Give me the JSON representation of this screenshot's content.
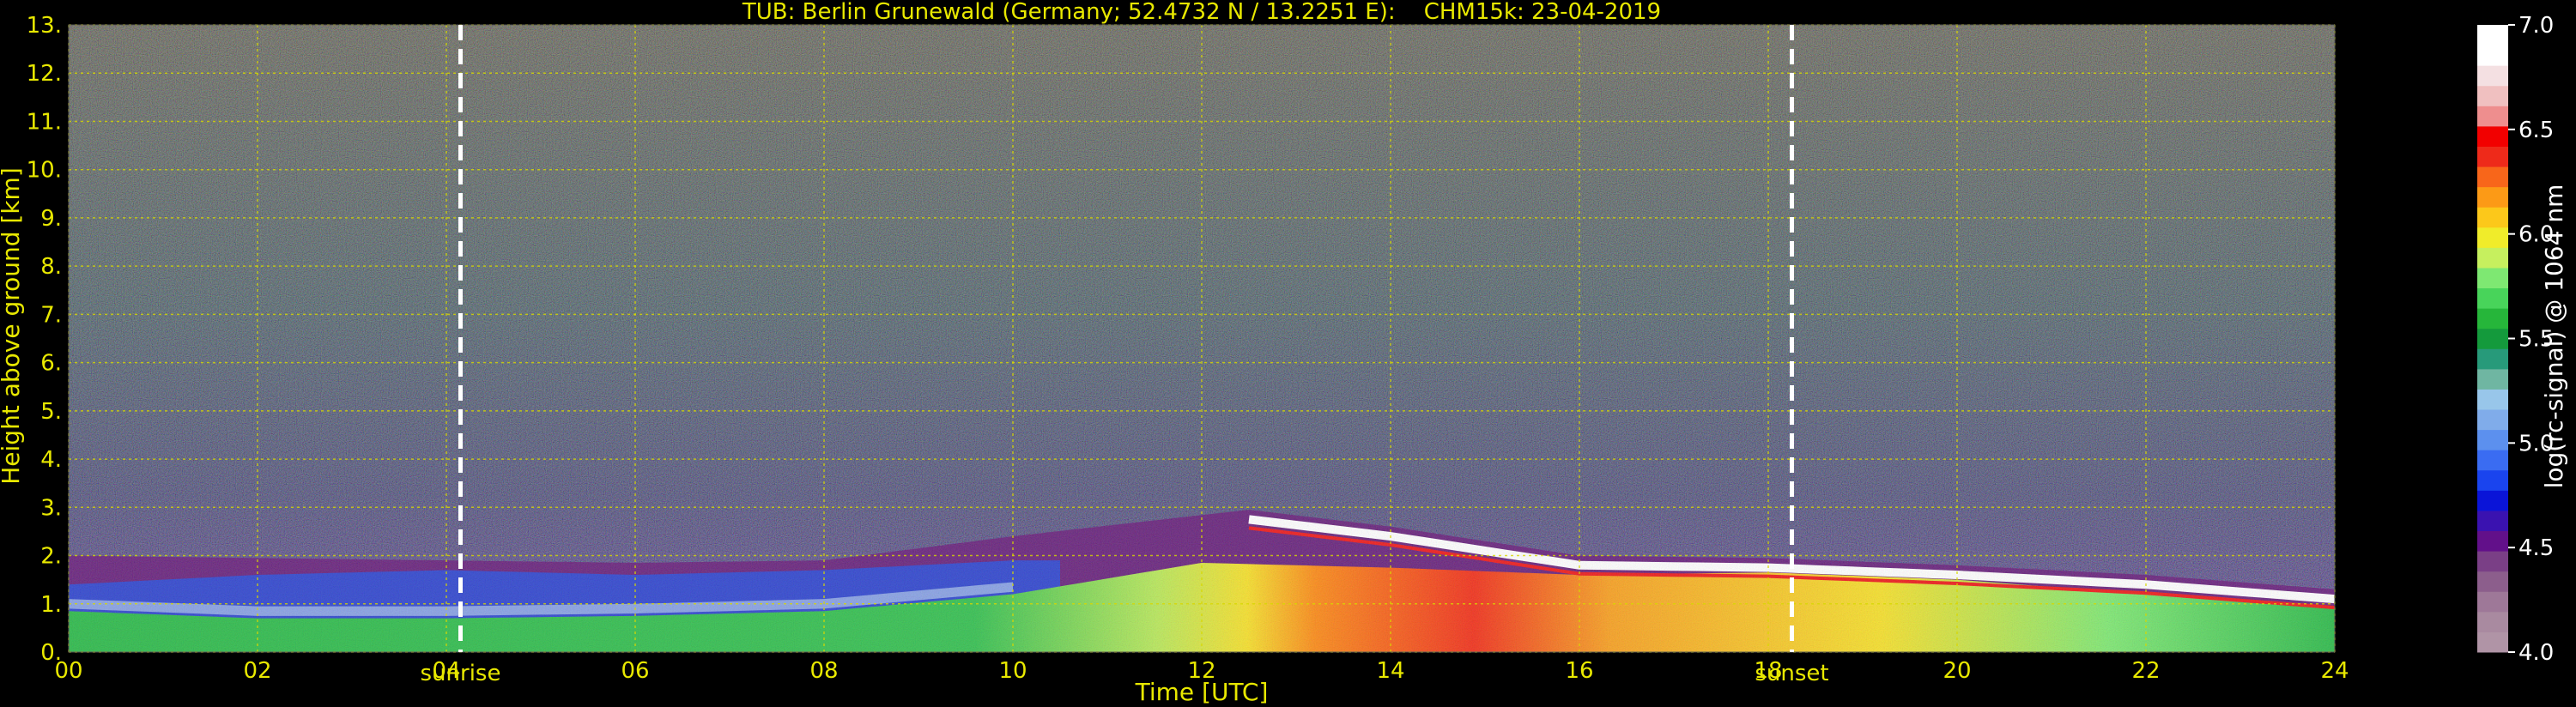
{
  "chart_data": {
    "type": "heatmap",
    "title": "TUB: Berlin Grunewald (Germany; 52.4732 N / 13.2251 E):    CHM15k: 23-04-2019",
    "xlabel": "Time [UTC]",
    "ylabel": "Height above ground [km]",
    "xlim": [
      0,
      24
    ],
    "ylim": [
      0,
      13
    ],
    "x_ticks": [
      "00",
      "02",
      "04",
      "06",
      "08",
      "10",
      "12",
      "14",
      "16",
      "18",
      "20",
      "22",
      "24"
    ],
    "y_ticks": [
      "0.",
      "1.",
      "2.",
      "3.",
      "4.",
      "5.",
      "6.",
      "7.",
      "8.",
      "9.",
      "10.",
      "11.",
      "12.",
      "13."
    ],
    "grid": true,
    "annotations": [
      {
        "label": "sunrise",
        "x": 4.15
      },
      {
        "label": "sunset",
        "x": 18.25
      }
    ],
    "colorbar": {
      "label": "log(rc-signal) @ 1064 nm",
      "range": [
        4.0,
        7.0
      ],
      "ticks": [
        "4.0",
        "4.5",
        "5.0",
        "5.5",
        "6.0",
        "6.5",
        "7.0"
      ],
      "colors": [
        "#b094a6",
        "#a98aa0",
        "#9e7898",
        "#8c5e8c",
        "#7a3f86",
        "#62108a",
        "#3a12b0",
        "#0a14d8",
        "#1a44ee",
        "#3a6cf2",
        "#5c90ee",
        "#80acea",
        "#98c6ea",
        "#6fb6a2",
        "#279a7a",
        "#149a3c",
        "#26b63a",
        "#48d45a",
        "#7ee872",
        "#c6f05e",
        "#f0ec2a",
        "#fcc81a",
        "#fc9a16",
        "#f8661a",
        "#ee2a1a",
        "#f20000",
        "#ee8e8e",
        "#f0c0c0",
        "#f4e0e2",
        "#ffffff",
        "#ffffff"
      ]
    },
    "layers": [
      {
        "name": "sky",
        "from": 3.8,
        "to": 13,
        "t0": 0,
        "t1": 24
      },
      {
        "name": "boundary_layer_top",
        "time": [
          0,
          2,
          4,
          6,
          8,
          10,
          12.5,
          14,
          16,
          18,
          20,
          22,
          24
        ],
        "height": [
          2.0,
          1.95,
          1.9,
          1.85,
          1.9,
          2.4,
          2.95,
          2.6,
          2.0,
          1.95,
          1.8,
          1.6,
          1.3
        ]
      },
      {
        "name": "residual_layer_top",
        "time": [
          0,
          2,
          4,
          6,
          8,
          10
        ],
        "height": [
          1.4,
          1.6,
          1.7,
          1.6,
          1.7,
          1.9
        ]
      },
      {
        "name": "mixed_layer_top",
        "time": [
          0,
          2,
          4,
          6,
          8,
          10,
          12,
          14,
          16,
          18,
          20,
          22,
          24
        ],
        "height": [
          0.85,
          0.7,
          0.7,
          0.75,
          0.85,
          1.2,
          1.85,
          1.75,
          1.6,
          1.65,
          1.5,
          1.2,
          0.95
        ]
      }
    ]
  }
}
